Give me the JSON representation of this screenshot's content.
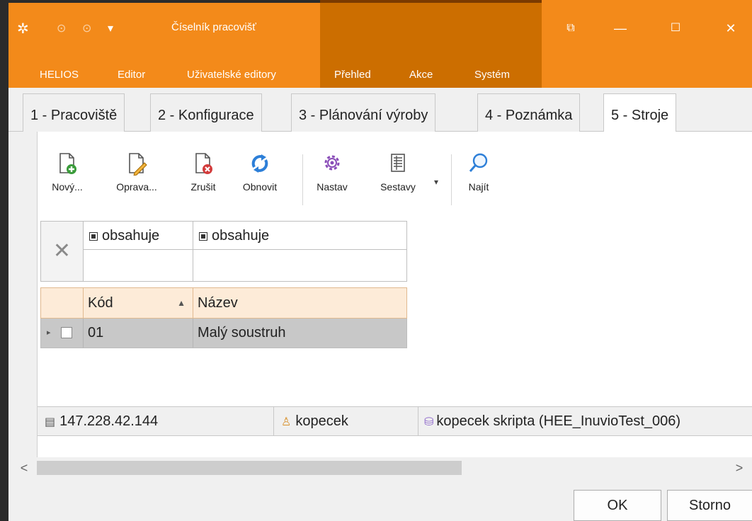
{
  "window": {
    "title": "Číselník pracovišť",
    "buttons": {
      "restore_icon": "⧉",
      "minimize": "—",
      "maximize": "☐",
      "close": "✕"
    }
  },
  "quick_access": {
    "app_icon": "✲",
    "back": "⊙",
    "forward": "⊙",
    "dropdown": "▾"
  },
  "menu": {
    "items": [
      "HELIOS",
      "Editor",
      "Uživatelské editory",
      "Přehled",
      "Akce",
      "Systém"
    ]
  },
  "tabs": [
    "1 - Pracoviště",
    "2 - Konfigurace",
    "3 - Plánování výroby",
    "4 - Poznámka",
    "5 - Stroje"
  ],
  "active_tab": "5 - Stroje",
  "toolbar": {
    "new": "Nový...",
    "edit": "Oprava...",
    "delete": "Zrušit",
    "refresh": "Obnovit",
    "settings": "Nastav",
    "reports": "Sestavy",
    "find": "Najít"
  },
  "filter": {
    "clear_icon": "✕",
    "columns": [
      "obsahuje",
      "obsahuje"
    ],
    "values": [
      "",
      ""
    ]
  },
  "grid": {
    "columns": [
      "Kód",
      "Název"
    ],
    "sort_indicator": "▲",
    "rows": [
      {
        "code": "01",
        "name": "Malý soustruh"
      }
    ]
  },
  "status": {
    "server": "147.228.42.144",
    "user": "kopecek",
    "database": "kopecek skripta (HEE_InuvioTest_006)"
  },
  "scroll": {
    "left": "<",
    "right": ">"
  },
  "buttons": {
    "ok": "OK",
    "cancel": "Storno"
  },
  "colors": {
    "accent": "#f38a1a",
    "accent_dark": "#cc6e00",
    "header_bg": "#fdebd8"
  }
}
